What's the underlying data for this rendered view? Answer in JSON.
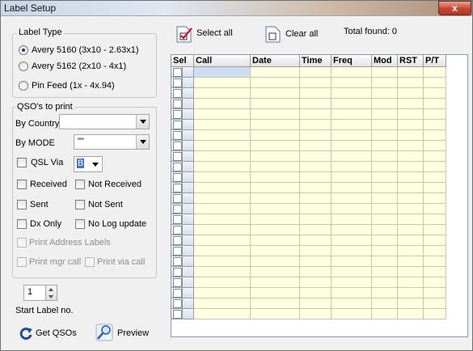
{
  "window": {
    "title": "Label Setup",
    "close_glyph": "x"
  },
  "label_type": {
    "title": "Label Type",
    "options": [
      {
        "label": "Avery 5160 (3x10 - 2.63x1)",
        "selected": true
      },
      {
        "label": "Avery 5162 (2x10 - 4x1)",
        "selected": false
      },
      {
        "label": "Pin Feed (1x - 4x.94)",
        "selected": false
      }
    ]
  },
  "qsos": {
    "title": "QSO's to print",
    "by_country_label": "By Country",
    "by_country_value": "",
    "by_mode_label": "By MODE",
    "by_mode_value": "\"\"",
    "qsl_via_label": "QSL Via",
    "qsl_via_value": "B",
    "received": "Received",
    "not_received": "Not Received",
    "sent": "Sent",
    "not_sent": "Not Sent",
    "dx_only": "Dx Only",
    "no_log_update": "No Log update",
    "print_address": "Print Address Labels",
    "print_mgr": "Print mgr call",
    "print_via": "Print via call"
  },
  "start_label": {
    "value": "1",
    "label": "Start Label no."
  },
  "actions": {
    "get_qsos": "Get QSOs",
    "preview": "Preview"
  },
  "toolbar": {
    "select_all": "Select all",
    "clear_all": "Clear all",
    "total_found": "Total found: 0"
  },
  "grid": {
    "columns": [
      "Sel",
      "Call",
      "Date",
      "Time",
      "Freq",
      "Mod",
      "RST",
      "P/T"
    ],
    "row_count": 24
  },
  "colors": {
    "grid_fill": "#ffffe1",
    "first_cell": "#cddcf0",
    "accent_icon": "#c8102e"
  }
}
